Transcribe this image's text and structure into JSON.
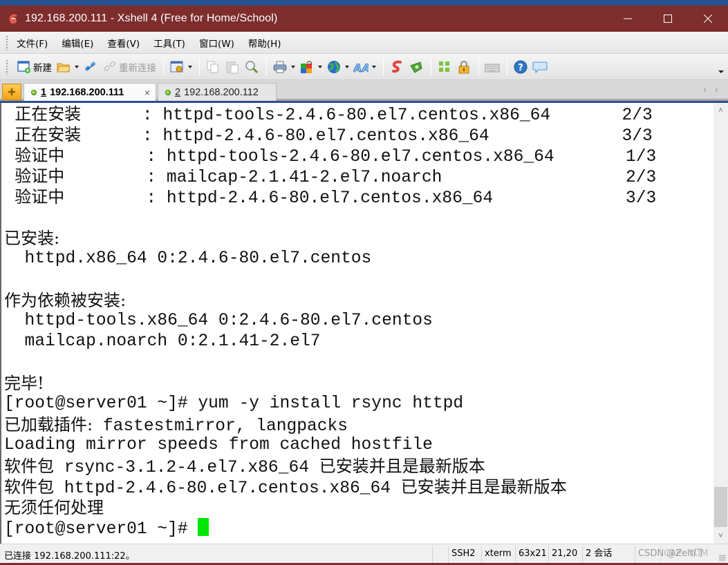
{
  "window": {
    "title": "192.168.200.111 - Xshell 4 (Free for Home/School)",
    "controls": [
      "minimize",
      "maximize",
      "close"
    ]
  },
  "menubar": {
    "items": [
      {
        "label": "文件(F)"
      },
      {
        "label": "编辑(E)"
      },
      {
        "label": "查看(V)"
      },
      {
        "label": "工具(T)"
      },
      {
        "label": "窗口(W)"
      },
      {
        "label": "帮助(H)"
      }
    ]
  },
  "toolbar": {
    "new_label": "新建",
    "reconnect_label": "重新连接",
    "icons": [
      "new-session-icon",
      "open-folder-icon",
      "connect-icon",
      "reconnect-icon",
      "properties-icon",
      "copy-icon",
      "paste-icon",
      "find-icon",
      "print-icon",
      "color-scheme-icon",
      "globe-icon",
      "font-icon",
      "xftp-icon",
      "xmanager-icon",
      "fullscreen-icon",
      "lock-icon",
      "keyboard-icon",
      "help-icon",
      "chat-icon"
    ]
  },
  "tabs": [
    {
      "num": "1",
      "label": "192.168.200.111",
      "active": true,
      "status": "connected",
      "close": "×"
    },
    {
      "num": "2",
      "label": "192.168.200.112",
      "active": false,
      "status": "connected"
    }
  ],
  "terminal": {
    "lines": [
      {
        "cjk": "  正在安装",
        "text": "      : httpd-tools-2.4.6-80.el7.centos.x86_64       2/3"
      },
      {
        "cjk": "  正在安装",
        "text": "      : httpd-2.4.6-80.el7.centos.x86_64             3/3"
      },
      {
        "cjk": "  验证中",
        "text": "        : httpd-tools-2.4.6-80.el7.centos.x86_64       1/3"
      },
      {
        "cjk": "  验证中",
        "text": "        : mailcap-2.1.41-2.el7.noarch                  2/3"
      },
      {
        "cjk": "  验证中",
        "text": "        : httpd-2.4.6-80.el7.centos.x86_64             3/3"
      },
      {
        "cjk": "",
        "text": ""
      },
      {
        "cjk": "已安装:",
        "text": ""
      },
      {
        "cjk": "",
        "text": "  httpd.x86_64 0:2.4.6-80.el7.centos"
      },
      {
        "cjk": "",
        "text": ""
      },
      {
        "cjk": "作为依赖被安装:",
        "text": ""
      },
      {
        "cjk": "",
        "text": "  httpd-tools.x86_64 0:2.4.6-80.el7.centos"
      },
      {
        "cjk": "",
        "text": "  mailcap.noarch 0:2.1.41-2.el7"
      },
      {
        "cjk": "",
        "text": ""
      },
      {
        "cjk": "完毕!",
        "text": ""
      },
      {
        "cjk": "",
        "text": "[root@server01 ~]# yum -y install rsync httpd"
      },
      {
        "cjk": "已加载插件:",
        "text": " fastestmirror, langpacks"
      },
      {
        "cjk": "",
        "text": "Loading mirror speeds from cached hostfile"
      },
      {
        "cjk": "软件包",
        "text": " rsync-3.1.2-4.el7.x86_64 ",
        "cjk2": "已安装并且是最新版本"
      },
      {
        "cjk": "软件包",
        "text": " httpd-2.4.6-80.el7.centos.x86_64 ",
        "cjk2": "已安装并且是最新版本"
      },
      {
        "cjk": "无须任何处理",
        "text": ""
      },
      {
        "cjk": "",
        "text": "[root@server01 ~]# "
      }
    ],
    "cursor_color": "#00e600"
  },
  "statusbar": {
    "connection": "已连接 192.168.200.111:22。",
    "protocol": "SSH2",
    "term_type": "xterm",
    "size": "63x21",
    "cursor_pos": "21,20",
    "sessions": "2 会话",
    "caps": "CAP",
    "num": "NUM",
    "watermark": "CSDN @Zeit门"
  },
  "colors": {
    "titlebar": "#7d2d2c",
    "cursor": "#00e600"
  }
}
